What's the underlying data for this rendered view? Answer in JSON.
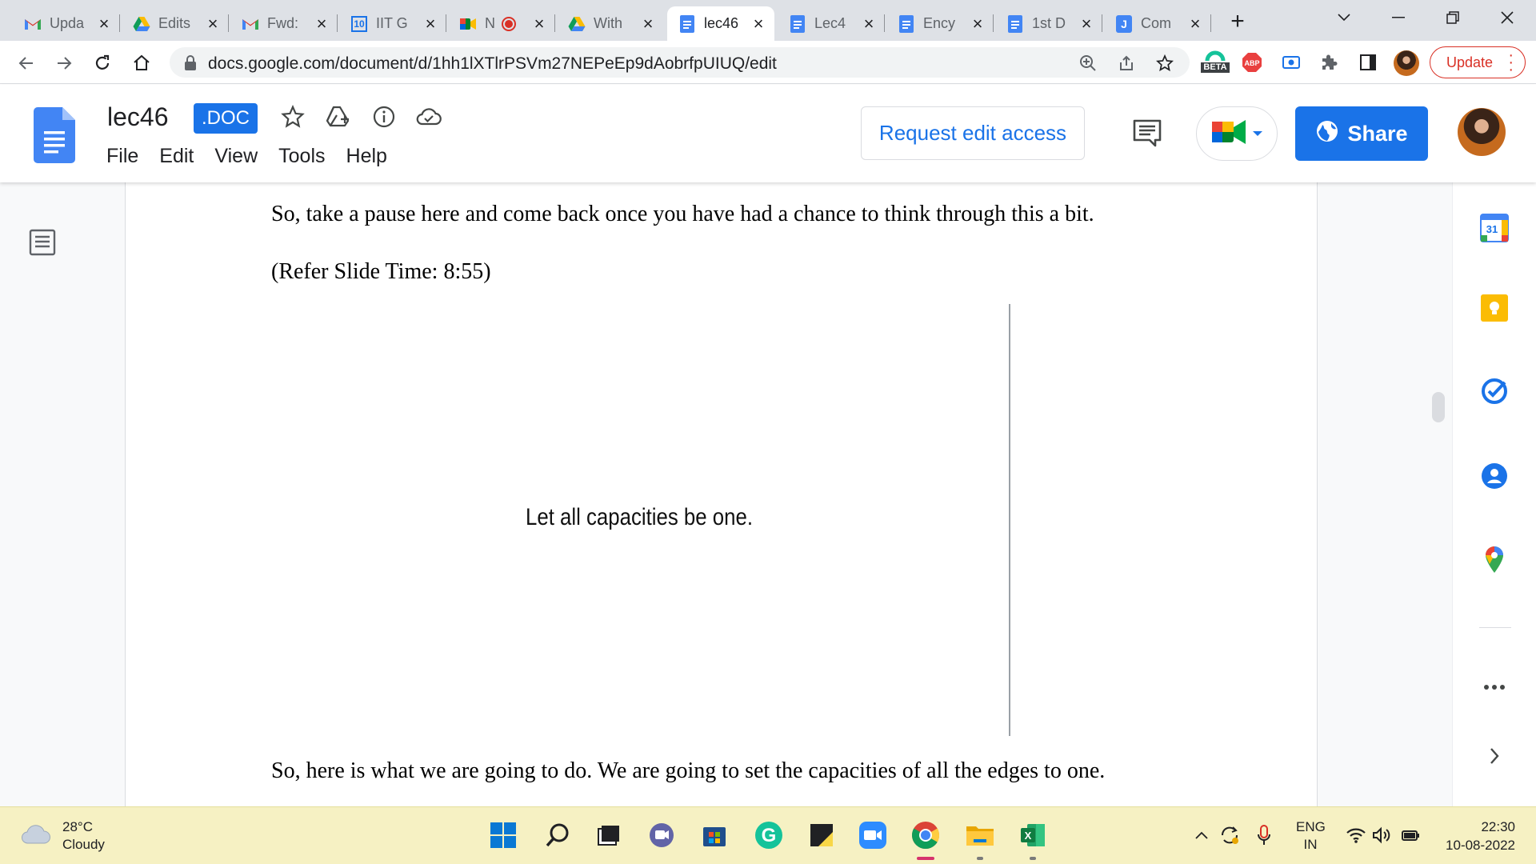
{
  "browser": {
    "tabs": [
      {
        "label": "Upda",
        "icon": "gmail-icon"
      },
      {
        "label": "Edits",
        "icon": "google-drive-icon"
      },
      {
        "label": "Fwd:",
        "icon": "gmail-icon"
      },
      {
        "label": "IIT G",
        "icon": "calendar-icon",
        "icon_text": "10"
      },
      {
        "label": "N",
        "icon": "google-meet-icon"
      },
      {
        "label": "With",
        "icon": "google-drive-icon"
      },
      {
        "label": "lec46",
        "icon": "google-docs-icon",
        "active": true
      },
      {
        "label": "Lec4",
        "icon": "google-docs-icon"
      },
      {
        "label": "Ency",
        "icon": "google-docs-icon"
      },
      {
        "label": "1st D",
        "icon": "google-docs-icon"
      },
      {
        "label": "Com",
        "icon": "jamboard-icon",
        "icon_text": "J"
      }
    ],
    "address": {
      "url": "docs.google.com/document/d/1hh1lXTlrPSVm27NEPeEp9dAobrfpUIUQ/edit"
    },
    "extensions": {
      "beta_label": "BETA",
      "abp_label": "ABP"
    },
    "update_label": "Update"
  },
  "docs": {
    "title": "lec46",
    "badge": ".DOC",
    "menu": [
      "File",
      "Edit",
      "View",
      "Tools",
      "Help"
    ],
    "request_edit_label": "Request edit access",
    "share_label": "Share"
  },
  "document": {
    "para_top": "So, take a pause here and come back once you have had a chance to think through this a bit.",
    "slide_ref": "(Refer Slide Time: 8:55)",
    "slide_text": "Let all capacities be one.",
    "para_bottom": "So, here is what we are going to do. We are going to set the capacities of all the edges to one."
  },
  "side_panel": {
    "items": [
      "calendar-icon",
      "keep-icon",
      "tasks-icon",
      "contacts-icon",
      "maps-icon"
    ],
    "calendar_day": "31"
  },
  "taskbar": {
    "weather_temp": "28°C",
    "weather_desc": "Cloudy",
    "lang_top": "ENG",
    "lang_bottom": "IN",
    "time": "22:30",
    "date": "10-08-2022"
  },
  "colors": {
    "accent": "#1a73e8",
    "update_red": "#d93025",
    "tabstrip": "#dee1e6",
    "taskbar": "#f6f1c3"
  }
}
